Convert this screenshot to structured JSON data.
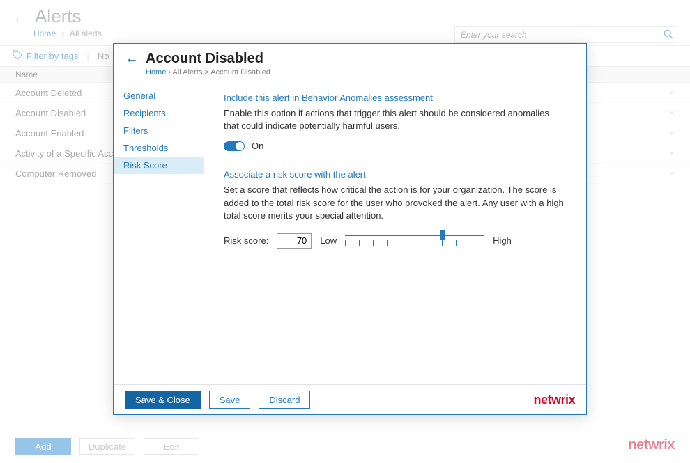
{
  "header": {
    "title": "Alerts",
    "crumb_home": "Home",
    "crumb_current": "All alerts"
  },
  "search": {
    "placeholder": "Enter your search"
  },
  "filter": {
    "label": "Filter by tags",
    "no_tags": "No"
  },
  "table": {
    "col_name": "Name",
    "rows": [
      {
        "name": "Account Deleted"
      },
      {
        "name": "Account Disabled"
      },
      {
        "name": "Account Enabled"
      },
      {
        "name": "Activity of a Specific Accou"
      },
      {
        "name": "Computer Removed"
      }
    ]
  },
  "bottom": {
    "add": "Add",
    "duplicate": "Duplicate",
    "edit": "Edit"
  },
  "brand": "netwrix",
  "modal": {
    "title": "Account Disabled",
    "crumb": {
      "home": "Home",
      "mid": "All Alerts",
      "current": "Account Disabled"
    },
    "nav": {
      "items": [
        "General",
        "Recipients",
        "Filters",
        "Thresholds",
        "Risk Score"
      ],
      "active_index": 4
    },
    "section1": {
      "title": "Include this alert in Behavior Anomalies assessment",
      "text": "Enable this option if actions that trigger this alert should be considered anomalies that could indicate potentially harmful users.",
      "toggle_label": "On",
      "toggle_on": true
    },
    "section2": {
      "title": "Associate a risk score with the alert",
      "text": "Set a score that reflects how critical the action is for your organization.  The score is added to the total risk score for the user who provoked the alert.  Any user with a high total score merits your special attention.",
      "score_label": "Risk score:",
      "score_value": "70",
      "low": "Low",
      "high": "High",
      "slider_percent": 70
    },
    "footer": {
      "save_close": "Save & Close",
      "save": "Save",
      "discard": "Discard"
    }
  }
}
